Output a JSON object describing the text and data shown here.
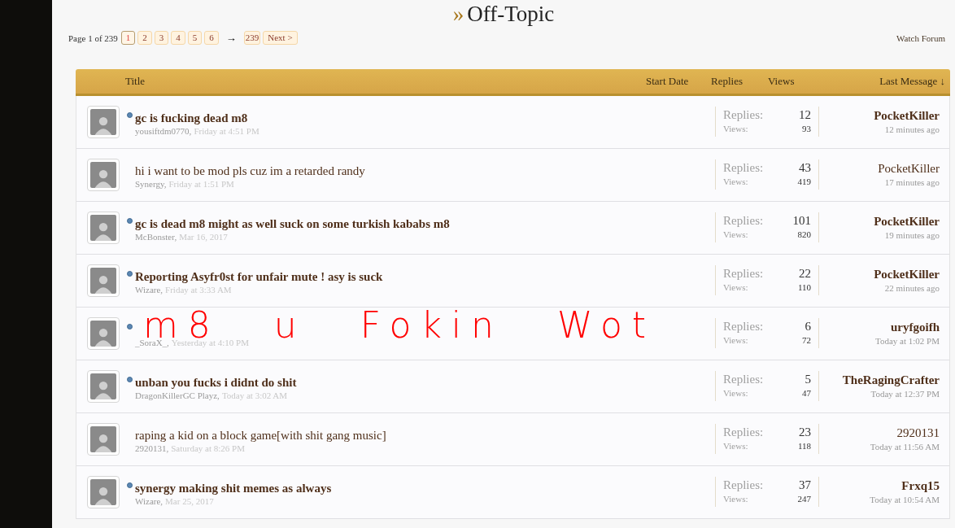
{
  "forum_title": {
    "marker": "»",
    "text": "Off-Topic"
  },
  "pagination": {
    "label": "Page 1 of 239",
    "pages": [
      {
        "label": "1",
        "selected": true
      },
      {
        "label": "2",
        "selected": false
      },
      {
        "label": "3",
        "selected": false
      },
      {
        "label": "4",
        "selected": false
      },
      {
        "label": "5",
        "selected": false
      },
      {
        "label": "6",
        "selected": false
      }
    ],
    "gap": "→",
    "last": "239",
    "next": "Next >"
  },
  "watch_forum": "Watch Forum",
  "table": {
    "columns": [
      "Title",
      "Start Date",
      "Replies",
      "Views",
      "Last Message ↓"
    ],
    "rows": [
      {
        "title": "gc is fucking dead m8",
        "unread": true,
        "author": "yousiftdm0770,",
        "date": "Friday at 4:51 PM",
        "replies": "12",
        "views": "93",
        "last_user": "PocketKiller",
        "last_time": "12 minutes ago"
      },
      {
        "title": "hi i want to be mod pls cuz im a retarded randy",
        "unread": false,
        "author": "Synergy,",
        "date": "Friday at 1:51 PM",
        "replies": "43",
        "views": "419",
        "last_user": "PocketKiller",
        "last_time": "17 minutes ago"
      },
      {
        "title": "gc is dead m8 might as well suck on some turkish kababs m8",
        "unread": true,
        "author": "McBonster,",
        "date": "Mar 16, 2017",
        "replies": "101",
        "views": "820",
        "last_user": "PocketKiller",
        "last_time": "19 minutes ago"
      },
      {
        "title": "Reporting Asyfr0st for unfair mute ! asy is suck",
        "unread": true,
        "author": "Wizare,",
        "date": "Friday at 3:33 AM",
        "replies": "22",
        "views": "110",
        "last_user": "PocketKiller",
        "last_time": "22 minutes ago"
      },
      {
        "unread": true,
        "author": "_SoraX_,",
        "date": "Yesterday at 4:10 PM",
        "replies": "6",
        "views": "72",
        "last_user": "uryfgoifh",
        "last_time": "Today at 1:02 PM"
      },
      {
        "title": "unban you fucks i didnt do shit",
        "unread": true,
        "author": "DragonKillerGC Playz,",
        "date": "Today at 3:02 AM",
        "replies": "5",
        "views": "47",
        "last_user": "TheRagingCrafter",
        "last_time": "Today at 12:37 PM"
      },
      {
        "title": "raping a kid on a block game[with shit gang music]",
        "unread": false,
        "author": "2920131,",
        "date": "Saturday at 8:26 PM",
        "replies": "23",
        "views": "118",
        "last_user": "2920131",
        "last_time": "Today at 11:56 AM"
      },
      {
        "title": "synergy making shit memes as always",
        "unread": true,
        "author": "Wizare,",
        "date": "Mar 25, 2017",
        "replies": "37",
        "views": "247",
        "last_user": "Frxq15",
        "last_time": "Today at 10:54 AM"
      }
    ],
    "stat_labels": [
      {
        "replies": "Replies:",
        "views": "Views:"
      },
      {
        "replies": "Replies:",
        "views": "Views:"
      },
      {
        "replies": "Replies:",
        "views": "Views:"
      },
      {
        "replies": "Replies:",
        "views": "Views:"
      },
      {
        "replies": "Replies:",
        "views": "Views:"
      },
      {
        "replies": "Replies:",
        "views": "Views:"
      },
      {
        "replies": "Replies:",
        "views": "Views:"
      },
      {
        "replies": "Replies:",
        "views": "Views:"
      }
    ]
  },
  "annotation": {
    "text": "m8 u Fokin Wot"
  }
}
